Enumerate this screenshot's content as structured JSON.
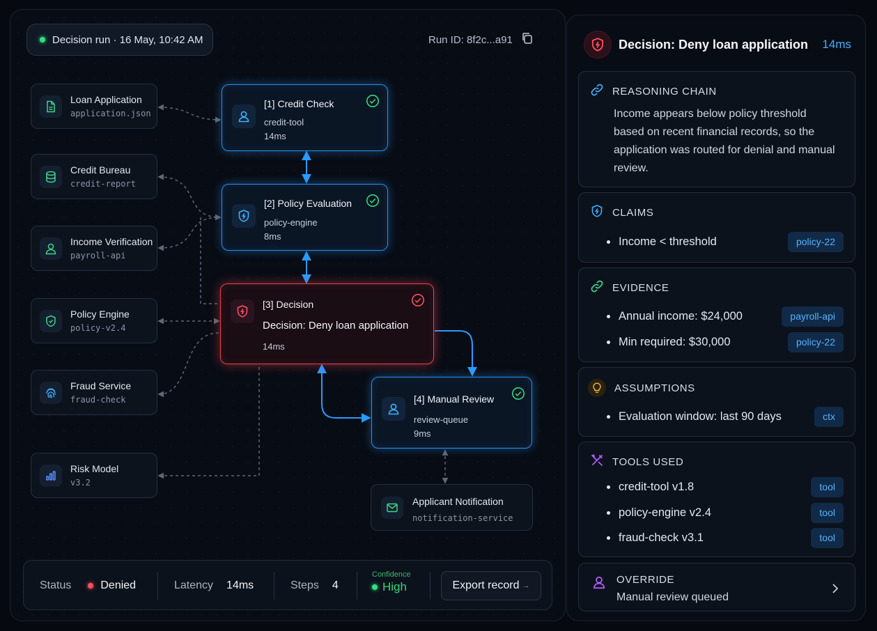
{
  "run": {
    "label": "Decision run · 16 May, 10:42 AM",
    "run_id": "Run ID: 8f2c...a91"
  },
  "sources": [
    {
      "title": "Loan Application",
      "sub": "application.json",
      "icon": "document-icon"
    },
    {
      "title": "Credit Bureau",
      "sub": "credit-report",
      "icon": "database-icon"
    },
    {
      "title": "Income Verification",
      "sub": "payroll-api",
      "icon": "user-icon"
    },
    {
      "title": "Policy Engine",
      "sub": "policy-v2.4",
      "icon": "shield-check-icon"
    },
    {
      "title": "Fraud Service",
      "sub": "fraud-check",
      "icon": "fingerprint-icon"
    },
    {
      "title": "Risk Model",
      "sub": "v3.2",
      "icon": "bar-chart-icon"
    }
  ],
  "steps": [
    {
      "title": "[1] Credit Check",
      "sub": "credit-tool",
      "time": "14ms"
    },
    {
      "title": "[2] Policy Evaluation",
      "sub": "policy-engine",
      "time": "8ms"
    },
    {
      "title": "[3] Decision",
      "sub": "Decision: Deny loan application",
      "time": "14ms"
    },
    {
      "title": "[4] Manual Review",
      "sub": "review-queue",
      "time": "9ms"
    }
  ],
  "notification": {
    "title": "Applicant Notification",
    "sub": "notification-service"
  },
  "status_bar": {
    "status_label": "Status",
    "status_value": "Denied",
    "latency_label": "Latency",
    "latency_value": "14ms",
    "steps_label": "Steps",
    "steps_value": "4",
    "confidence_label": "Confidence",
    "confidence_value": "High",
    "export_label": "Export record"
  },
  "panel": {
    "title": "Decision: Deny loan application",
    "ms": "14ms",
    "reasoning": {
      "label": "REASONING CHAIN",
      "text": "Income appears below policy threshold based on recent financial records, so the application was routed for denial and manual review."
    },
    "claims": {
      "label": "CLAIMS",
      "items": [
        {
          "text": "Income < threshold",
          "tag": "policy-22"
        }
      ]
    },
    "evidence": {
      "label": "EVIDENCE",
      "items": [
        {
          "text": "Annual income: $24,000",
          "tag": "payroll-api"
        },
        {
          "text": "Min required: $30,000",
          "tag": "policy-22"
        }
      ]
    },
    "assumptions": {
      "label": "ASSUMPTIONS",
      "items": [
        {
          "text": "Evaluation window: last 90 days",
          "tag": "ctx"
        }
      ]
    },
    "tools": {
      "label": "TOOLS USED",
      "items": [
        {
          "text": "credit-tool v1.8",
          "tag": "tool"
        },
        {
          "text": "policy-engine v2.4",
          "tag": "tool"
        },
        {
          "text": "fraud-check v3.1",
          "tag": "tool"
        }
      ]
    },
    "override": {
      "label": "OVERRIDE",
      "text": "Manual review queued"
    }
  },
  "colors": {
    "accent": "#2a8fe8",
    "danger": "#e8434f",
    "success": "#2ee27a",
    "tag_text": "#56b2ff"
  }
}
